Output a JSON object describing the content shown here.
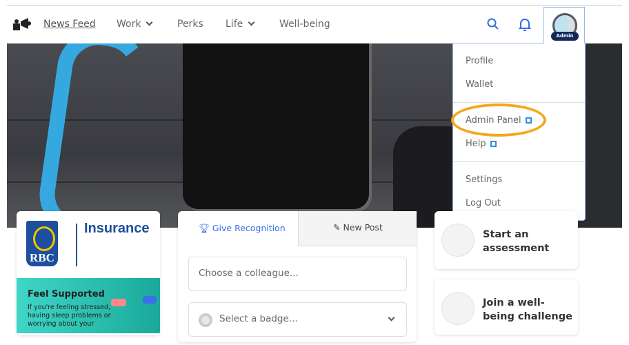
{
  "nav": {
    "items": [
      {
        "label": "News Feed",
        "active": true
      },
      {
        "label": "Work",
        "dropdown": true
      },
      {
        "label": "Perks"
      },
      {
        "label": "Life",
        "dropdown": true
      },
      {
        "label": "Well-being"
      }
    ],
    "icons": [
      "search-icon",
      "bell-icon"
    ],
    "avatar_badge": "Admin",
    "accent": "#2f6fe0"
  },
  "menu": {
    "items": [
      "Profile",
      "Wallet",
      "Admin Panel",
      "Help",
      "Settings",
      "Log Out"
    ],
    "highlight_color": "#f2a81d"
  },
  "brand": {
    "logo_text": "RBC",
    "product": "Insurance"
  },
  "promo": {
    "title": "Feel Supported",
    "body": "If you're feeling stressed, having sleep problems or worrying about your"
  },
  "composer": {
    "tabs": [
      "Give Recognition",
      "New Post"
    ],
    "colleague_placeholder": "Choose a colleague...",
    "badge_placeholder": "Select a badge..."
  },
  "actions": [
    "Start an assessment",
    "Join a well-being challenge"
  ]
}
